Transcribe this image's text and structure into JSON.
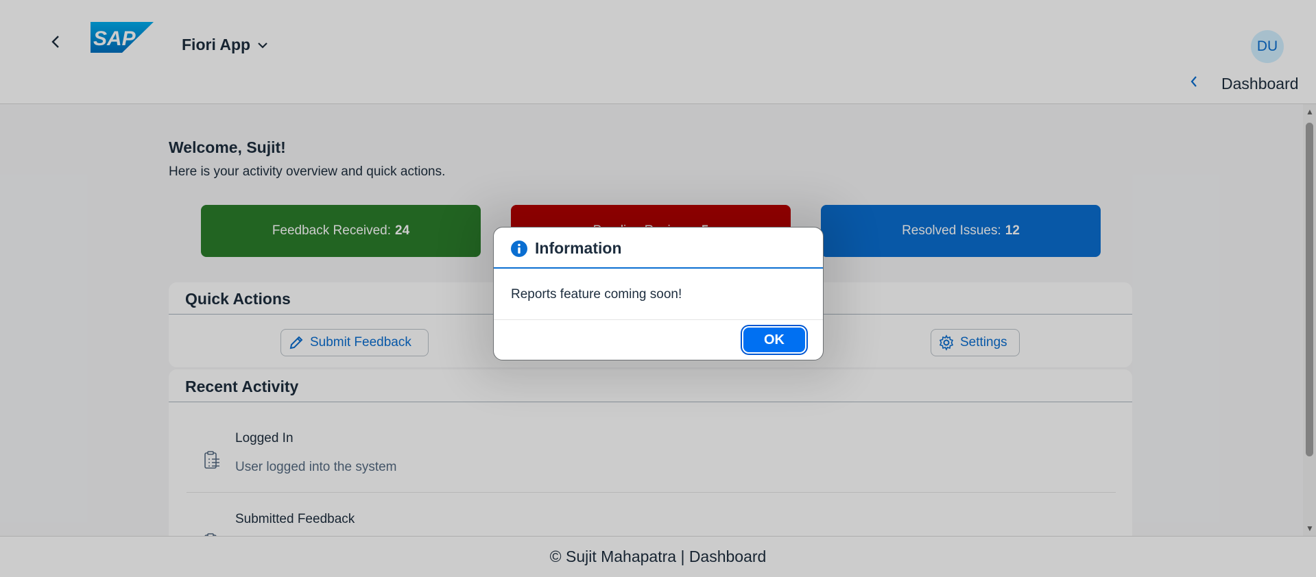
{
  "shell": {
    "logo_text": "SAP",
    "app_title": "Fiori App",
    "avatar_initials": "DU"
  },
  "subheader": {
    "title": "Dashboard"
  },
  "welcome": {
    "title": "Welcome, Sujit!",
    "subtitle": "Here is your activity overview and quick actions."
  },
  "tiles": [
    {
      "label": "Feedback Received:",
      "value": "24",
      "color": "#2b7d2b"
    },
    {
      "label": "Pending Reviews:",
      "value": "5",
      "color": "#bb0000"
    },
    {
      "label": "Resolved Issues:",
      "value": "12",
      "color": "#0a6ed1"
    }
  ],
  "quick_actions": {
    "title": "Quick Actions",
    "buttons": [
      {
        "label": "Submit Feedback",
        "icon": "pencil-icon"
      },
      {
        "label": "Settings",
        "icon": "gear-icon"
      }
    ]
  },
  "recent_activity": {
    "title": "Recent Activity",
    "items": [
      {
        "title": "Logged In",
        "description": "User logged into the system",
        "icon": "clipboard-list-icon"
      },
      {
        "title": "Submitted Feedback",
        "icon": "clipboard-list-icon"
      }
    ]
  },
  "footer": {
    "text": "© Sujit Mahapatra | Dashboard"
  },
  "dialog": {
    "title": "Information",
    "message": "Reports feature coming soon!",
    "ok_label": "OK",
    "icon": "info-icon"
  },
  "colors": {
    "accent": "#0a6ed1",
    "emphasized_button": "#0070f2"
  }
}
